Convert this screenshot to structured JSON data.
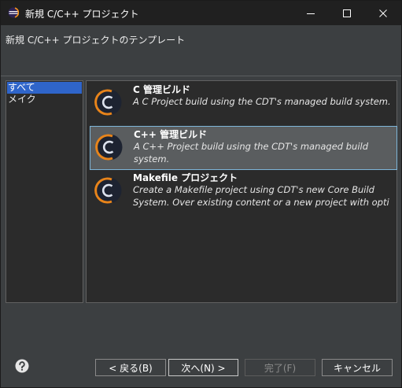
{
  "window": {
    "title": "新規 C/C++ プロジェクト"
  },
  "header": {
    "title": "新規 C/C++ プロジェクトのテンプレート"
  },
  "categories": [
    {
      "label": "すべて",
      "selected": true
    },
    {
      "label": "メイク",
      "selected": false
    }
  ],
  "templates": [
    {
      "name": "C 管理ビルド",
      "description": "A C Project build using the CDT's managed build system.",
      "selected": false
    },
    {
      "name": "C++ 管理ビルド",
      "description": "A C++ Project build using the CDT's managed build system.",
      "selected": true
    },
    {
      "name": "Makefile プロジェクト",
      "description": "Create a Makefile project using CDT's new Core Build System. Over existing content or a new project with opti",
      "selected": false
    }
  ],
  "buttons": {
    "back": "< 戻る(B)",
    "next": "次へ(N) >",
    "finish": "完了(F)",
    "cancel": "キャンセル"
  },
  "colors": {
    "selection": "#2f65ca",
    "item_selected_border": "#7eb5d8",
    "background": "#3c3f41",
    "list_background": "#2b2b2b",
    "icon_orange": "#e8841a"
  }
}
